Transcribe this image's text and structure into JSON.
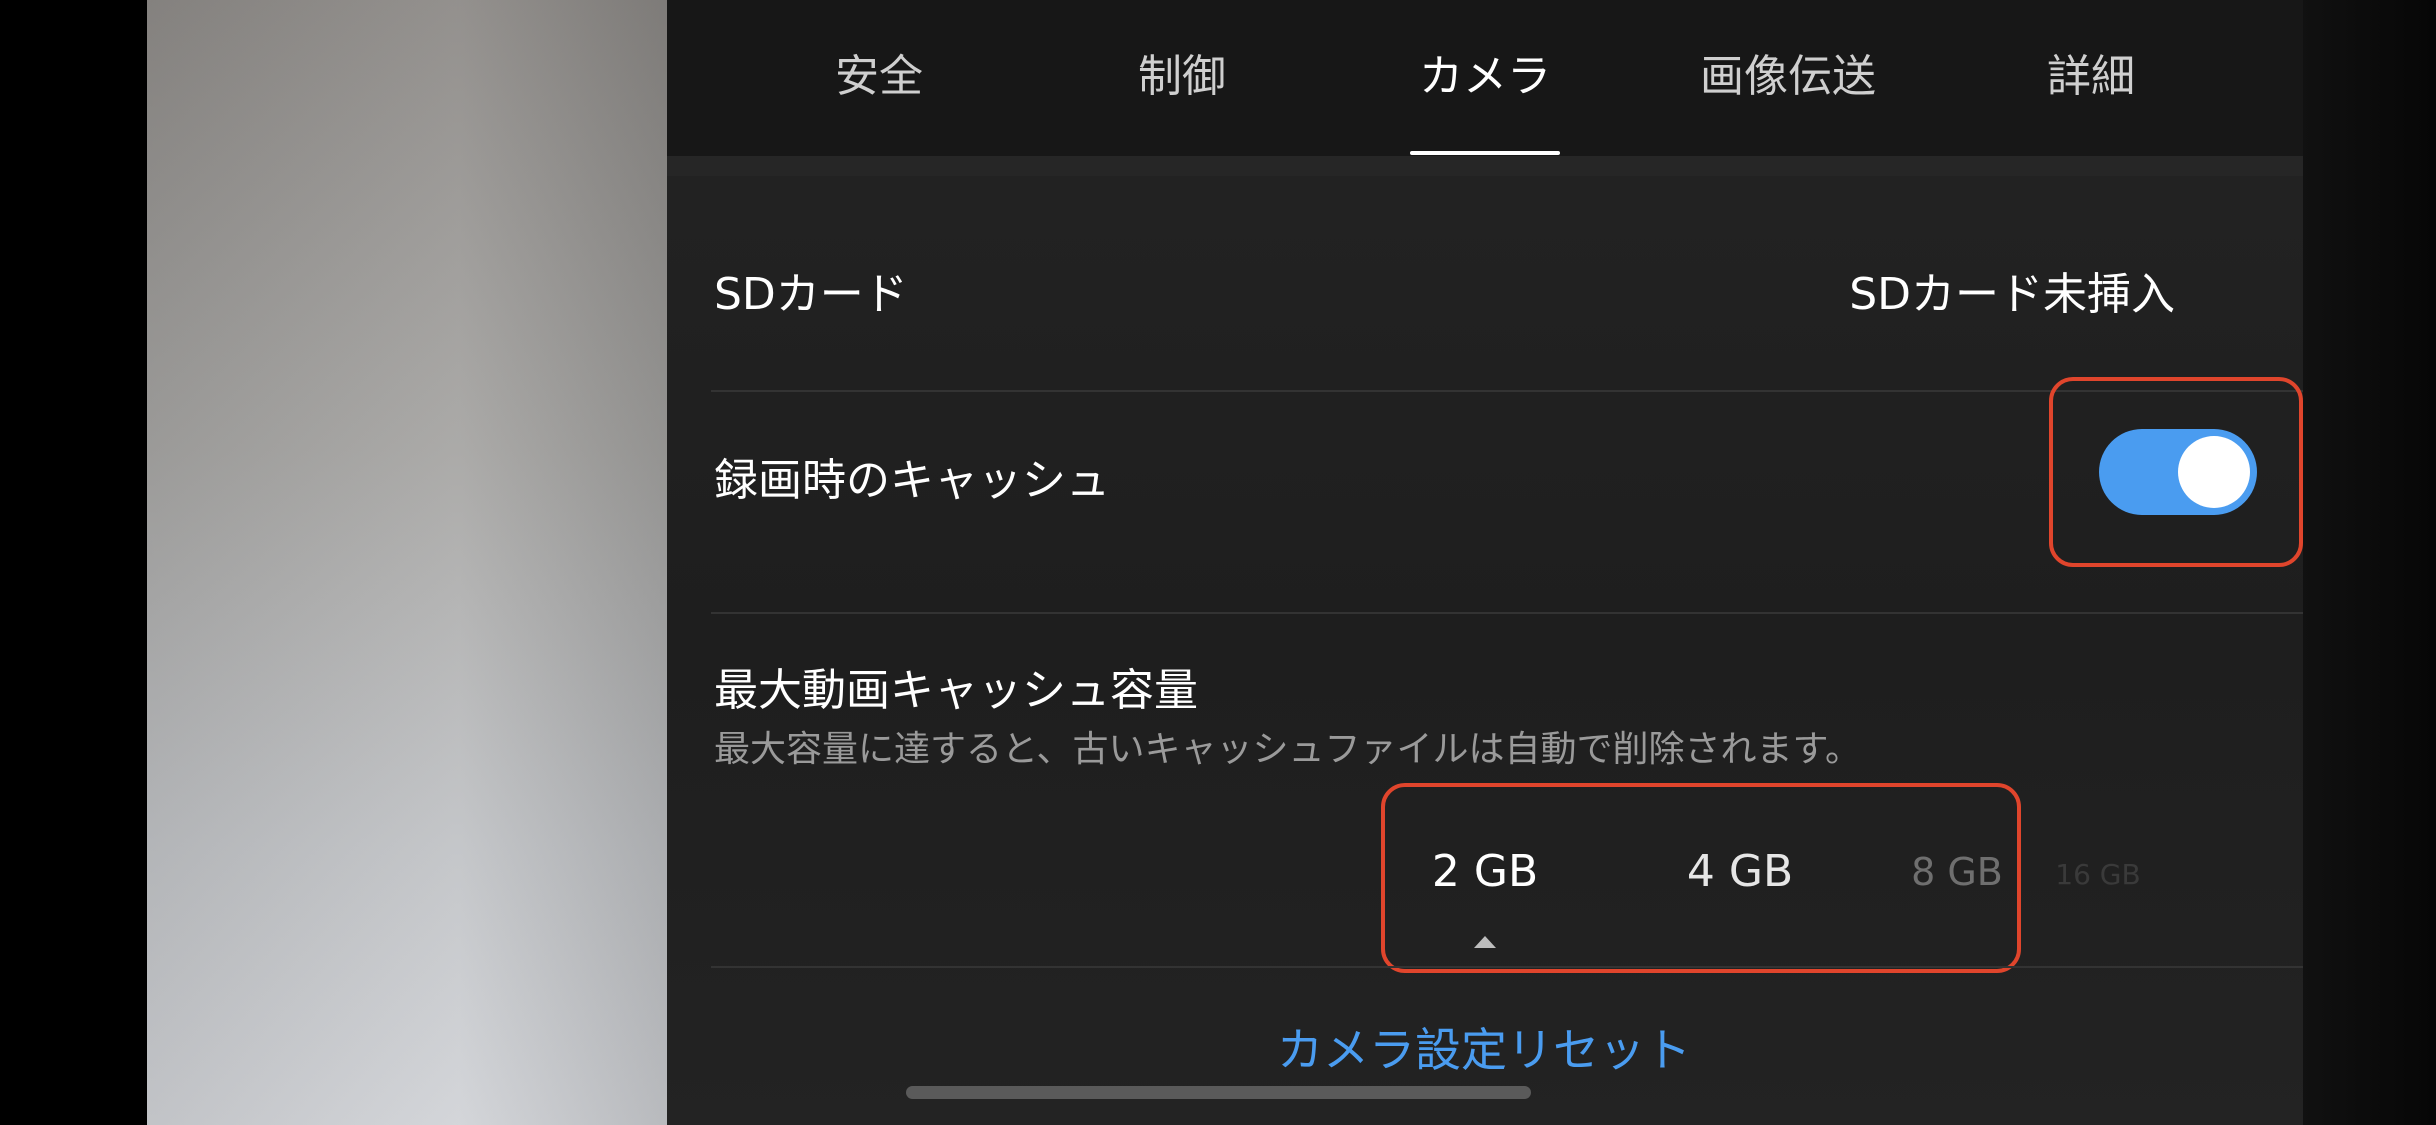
{
  "tabs": [
    {
      "label": "安全",
      "active": false
    },
    {
      "label": "制御",
      "active": false
    },
    {
      "label": "カメラ",
      "active": true
    },
    {
      "label": "画像伝送",
      "active": false
    },
    {
      "label": "詳細",
      "active": false
    }
  ],
  "sd_card": {
    "label": "SDカード",
    "status": "SDカード未挿入"
  },
  "recording_cache": {
    "label": "録画時のキャッシュ",
    "enabled": true
  },
  "max_cache": {
    "title": "最大動画キャッシュ容量",
    "description": "最大容量に達すると、古いキャッシュファイルは自動で削除されます。",
    "options": [
      "2 GB",
      "4 GB",
      "8 GB",
      "16 GB"
    ],
    "selected": "2 GB"
  },
  "reset_button": "カメラ設定リセット",
  "colors": {
    "accent": "#4a9cf0",
    "highlight": "#e0452c"
  }
}
